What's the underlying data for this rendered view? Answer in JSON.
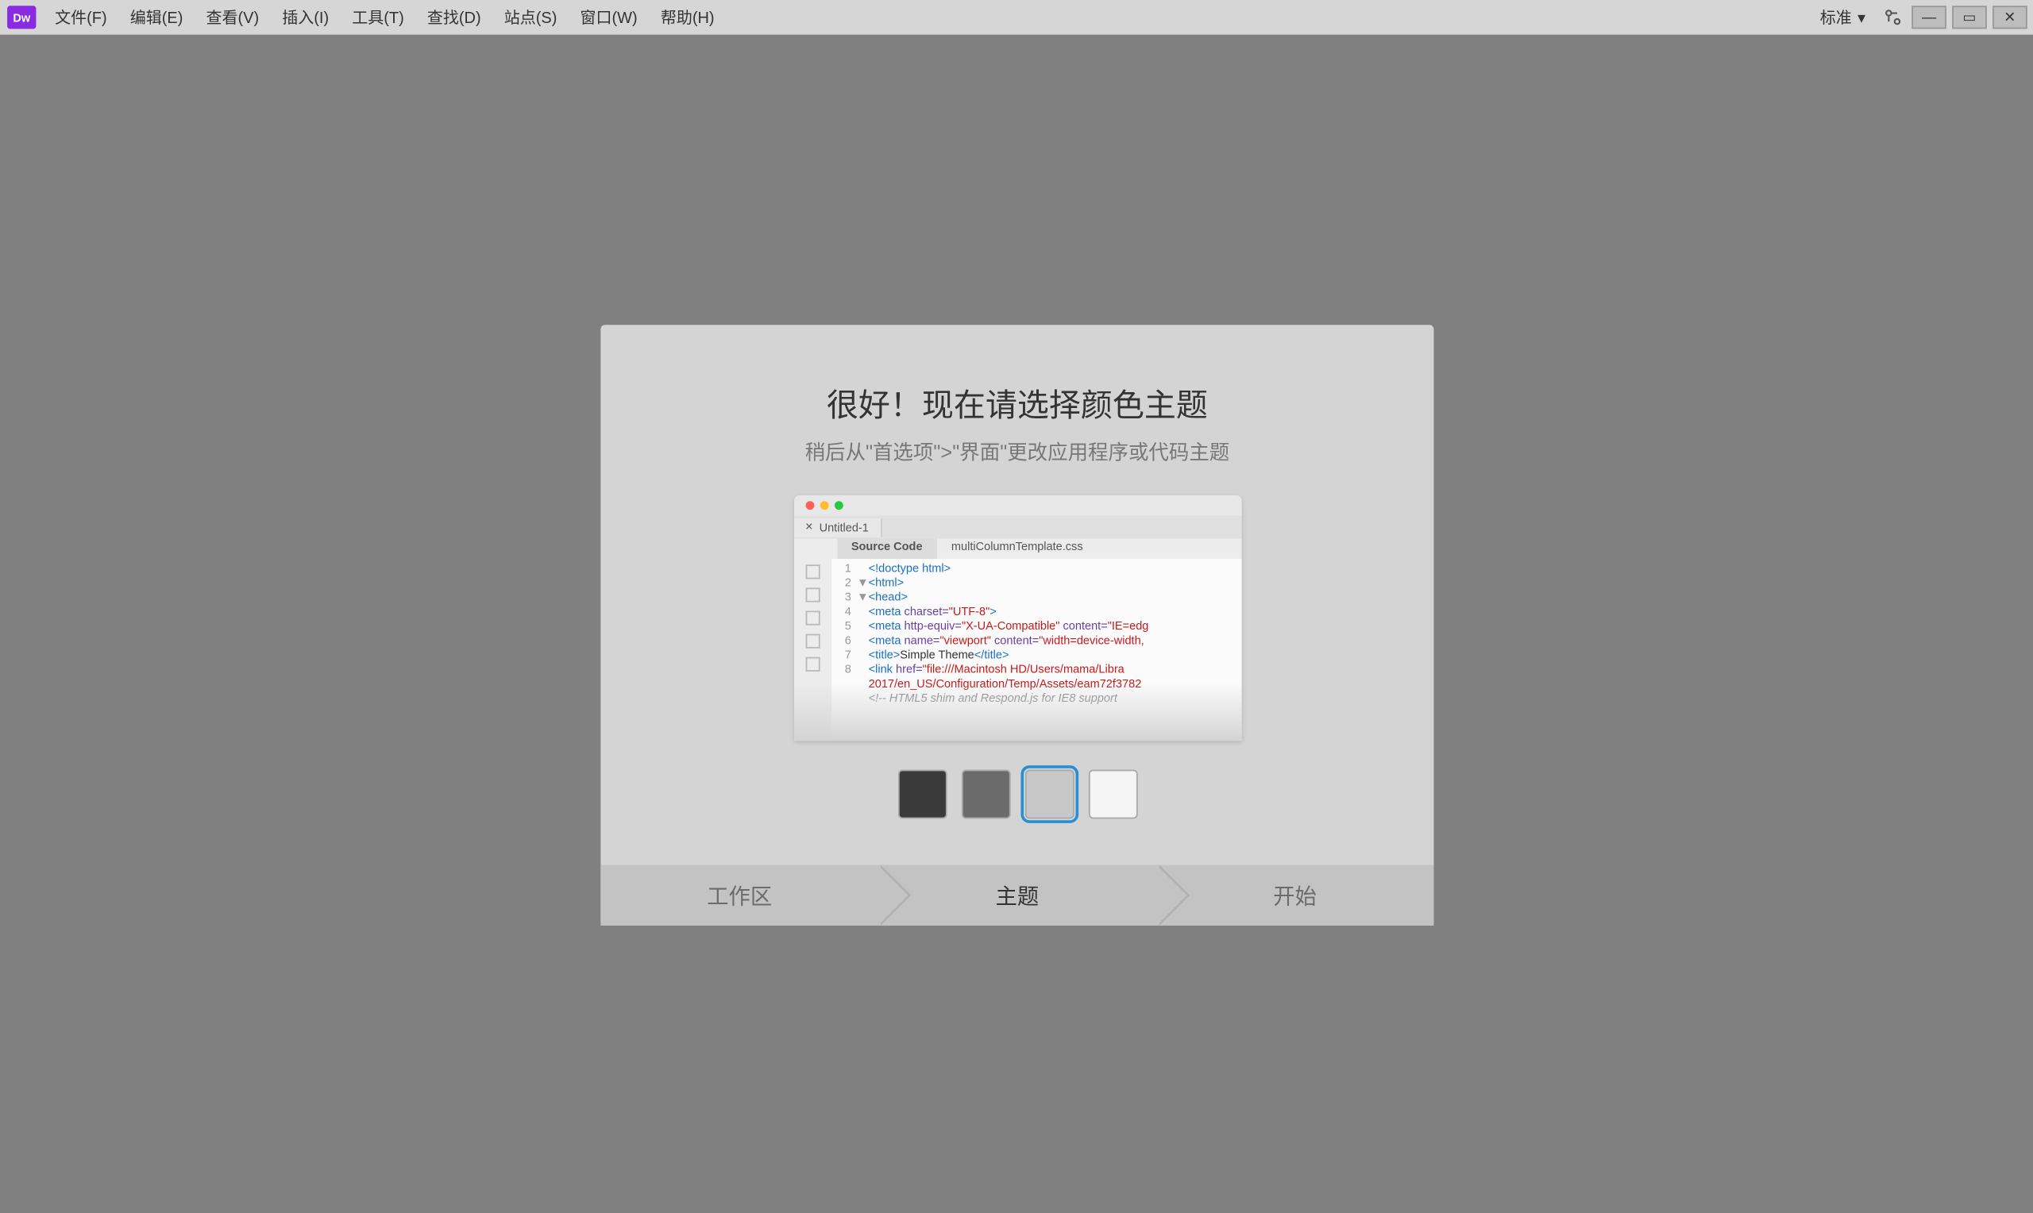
{
  "app_icon": "Dw",
  "menu": [
    "文件(F)",
    "编辑(E)",
    "查看(V)",
    "插入(I)",
    "工具(T)",
    "查找(D)",
    "站点(S)",
    "窗口(W)",
    "帮助(H)"
  ],
  "workspace_label": "标准",
  "dialog": {
    "title": "很好！现在请选择颜色主题",
    "subtitle": "稍后从\"首选项\">\"界面\"更改应用程序或代码主题"
  },
  "preview": {
    "file_tab": "Untitled-1",
    "subtabs": [
      "Source Code",
      "multiColumnTemplate.css"
    ],
    "code": [
      {
        "n": "1",
        "f": "",
        "h": "<span class='t-tag'>&lt;!doctype html&gt;</span>"
      },
      {
        "n": "2",
        "f": "▼",
        "h": "<span class='t-tag'>&lt;html&gt;</span>"
      },
      {
        "n": "3",
        "f": "▼",
        "h": "<span class='t-tag'>&lt;head&gt;</span>"
      },
      {
        "n": "4",
        "f": "",
        "h": "<span class='t-tag'>&lt;meta</span> <span class='t-attr'>charset=</span><span class='t-str'>\"UTF-8\"</span><span class='t-tag'>&gt;</span>"
      },
      {
        "n": "5",
        "f": "",
        "h": "<span class='t-tag'>&lt;meta</span> <span class='t-attr'>http-equiv=</span><span class='t-str'>\"X-UA-Compatible\"</span> <span class='t-attr'>content=</span><span class='t-str'>\"IE=edg</span>"
      },
      {
        "n": "6",
        "f": "",
        "h": "<span class='t-tag'>&lt;meta</span> <span class='t-attr'>name=</span><span class='t-str'>\"viewport\"</span> <span class='t-attr'>content=</span><span class='t-str'>\"width=device-width,</span>"
      },
      {
        "n": "7",
        "f": "",
        "h": "<span class='t-tag'>&lt;title&gt;</span><span class='t-txt'>Simple Theme</span><span class='t-tag'>&lt;/title&gt;</span>"
      },
      {
        "n": "8",
        "f": "",
        "h": "<span class='t-tag'>&lt;link</span> <span class='t-attr'>href=</span><span class='t-str'>\"file:///Macintosh HD/Users/mama/Libra</span>"
      },
      {
        "n": "",
        "f": "",
        "h": "<span class='t-str'>2017/en_US/Configuration/Temp/Assets/eam72f3782</span>"
      },
      {
        "n": "",
        "f": "",
        "h": "<span class='t-cmt'>&lt;!-- HTML5 shim and Respond.js for IE8 support</span>"
      }
    ]
  },
  "swatches": [
    {
      "color": "#3a3a3a",
      "selected": false
    },
    {
      "color": "#6b6b6b",
      "selected": false
    },
    {
      "color": "#c8c8c8",
      "selected": true
    },
    {
      "color": "#f5f5f5",
      "selected": false
    }
  ],
  "steps": [
    {
      "label": "工作区",
      "active": false
    },
    {
      "label": "主题",
      "active": true
    },
    {
      "label": "开始",
      "active": false
    }
  ]
}
